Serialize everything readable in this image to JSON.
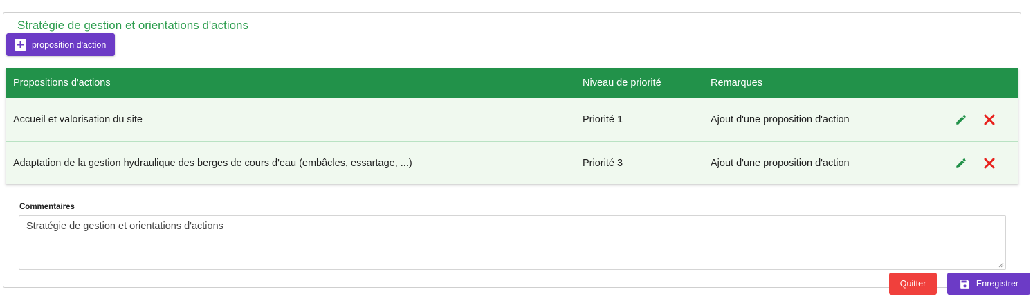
{
  "section": {
    "title": "Stratégie de gestion et orientations d'actions"
  },
  "toolbar": {
    "add_label": "proposition d'action",
    "add_icon": "plus-square-icon"
  },
  "table": {
    "headers": [
      "Propositions d'actions",
      "Niveau de priorité",
      "Remarques"
    ],
    "rows": [
      {
        "action": "Accueil et valorisation du site",
        "priority": "Priorité 1",
        "remark": "Ajout d'une proposition d'action"
      },
      {
        "action": "Adaptation de la gestion hydraulique des berges de cours d'eau (embâcles, essartage, ...)",
        "priority": "Priorité 3",
        "remark": "Ajout d'une proposition d'action"
      }
    ],
    "row_actions": [
      "pencil-icon",
      "close-icon"
    ]
  },
  "comments": {
    "label": "Commentaires",
    "value": "Stratégie de gestion et orientations d'actions"
  },
  "footer": {
    "quit_label": "Quitter",
    "save_label": "Enregistrer",
    "save_icon": "floppy-disk-icon"
  },
  "colors": {
    "accent_green": "#22924a",
    "legend_green": "#2e9e4f",
    "row_bg": "#f0f9ef",
    "primary_purple": "#6c3bc6",
    "danger_red": "#f0403c",
    "edit_icon": "#22924a",
    "delete_icon": "#e8211c"
  }
}
